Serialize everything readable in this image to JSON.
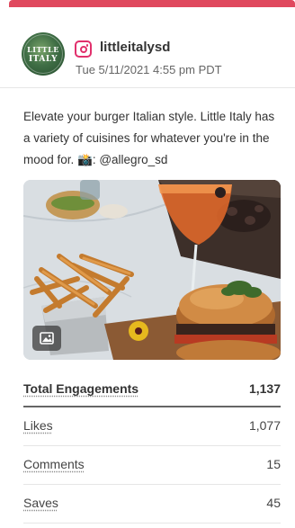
{
  "theme": {
    "accent": "#e0495e",
    "instagram": "#e1306c"
  },
  "account": {
    "avatar_text_top": "LITTLE",
    "avatar_text_bottom": "ITALY",
    "network_icon": "instagram-icon",
    "username": "littleitalysd",
    "timestamp": "Tue 5/11/2021 4:55 pm PDT"
  },
  "post": {
    "caption": "Elevate your burger Italian style. Little Italy has a variety of cuisines for whatever you're in the mood for. 📸: @allegro_sd",
    "media_type_icon": "image-icon"
  },
  "metrics": {
    "total": {
      "label": "Total Engagements",
      "value": "1,137"
    },
    "rows": [
      {
        "label": "Likes",
        "value": "1,077"
      },
      {
        "label": "Comments",
        "value": "15"
      },
      {
        "label": "Saves",
        "value": "45"
      }
    ]
  }
}
